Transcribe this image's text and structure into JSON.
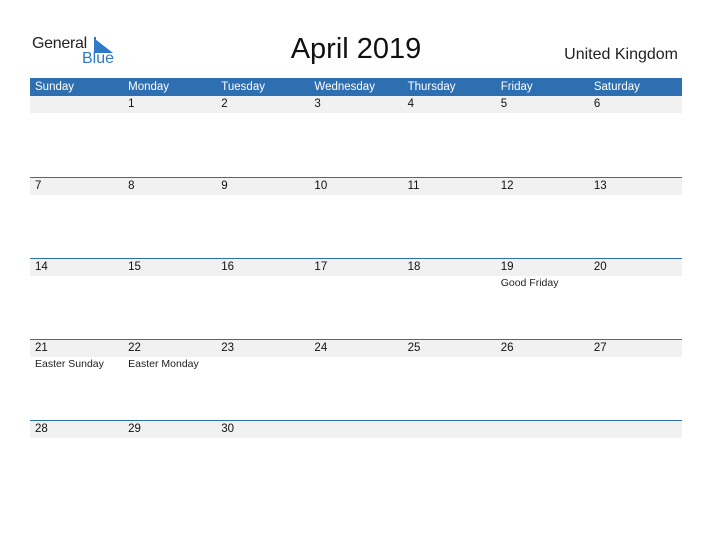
{
  "logo": {
    "line1": "General",
    "line2": "Blue"
  },
  "header": {
    "title": "April 2019",
    "country": "United Kingdom"
  },
  "colors": {
    "accent": "#2e6fb1",
    "strip": "#f1f1f1"
  },
  "days": [
    "Sunday",
    "Monday",
    "Tuesday",
    "Wednesday",
    "Thursday",
    "Friday",
    "Saturday"
  ],
  "weeks": [
    {
      "dates": [
        "",
        "1",
        "2",
        "3",
        "4",
        "5",
        "6"
      ],
      "holidays": [
        "",
        "",
        "",
        "",
        "",
        "",
        ""
      ]
    },
    {
      "dates": [
        "7",
        "8",
        "9",
        "10",
        "11",
        "12",
        "13"
      ],
      "holidays": [
        "",
        "",
        "",
        "",
        "",
        "",
        ""
      ]
    },
    {
      "dates": [
        "14",
        "15",
        "16",
        "17",
        "18",
        "19",
        "20"
      ],
      "holidays": [
        "",
        "",
        "",
        "",
        "",
        "Good Friday",
        ""
      ]
    },
    {
      "dates": [
        "21",
        "22",
        "23",
        "24",
        "25",
        "26",
        "27"
      ],
      "holidays": [
        "Easter Sunday",
        "Easter Monday",
        "",
        "",
        "",
        "",
        ""
      ]
    },
    {
      "dates": [
        "28",
        "29",
        "30",
        "",
        "",
        "",
        ""
      ],
      "holidays": [
        "",
        "",
        "",
        "",
        "",
        "",
        ""
      ]
    }
  ]
}
